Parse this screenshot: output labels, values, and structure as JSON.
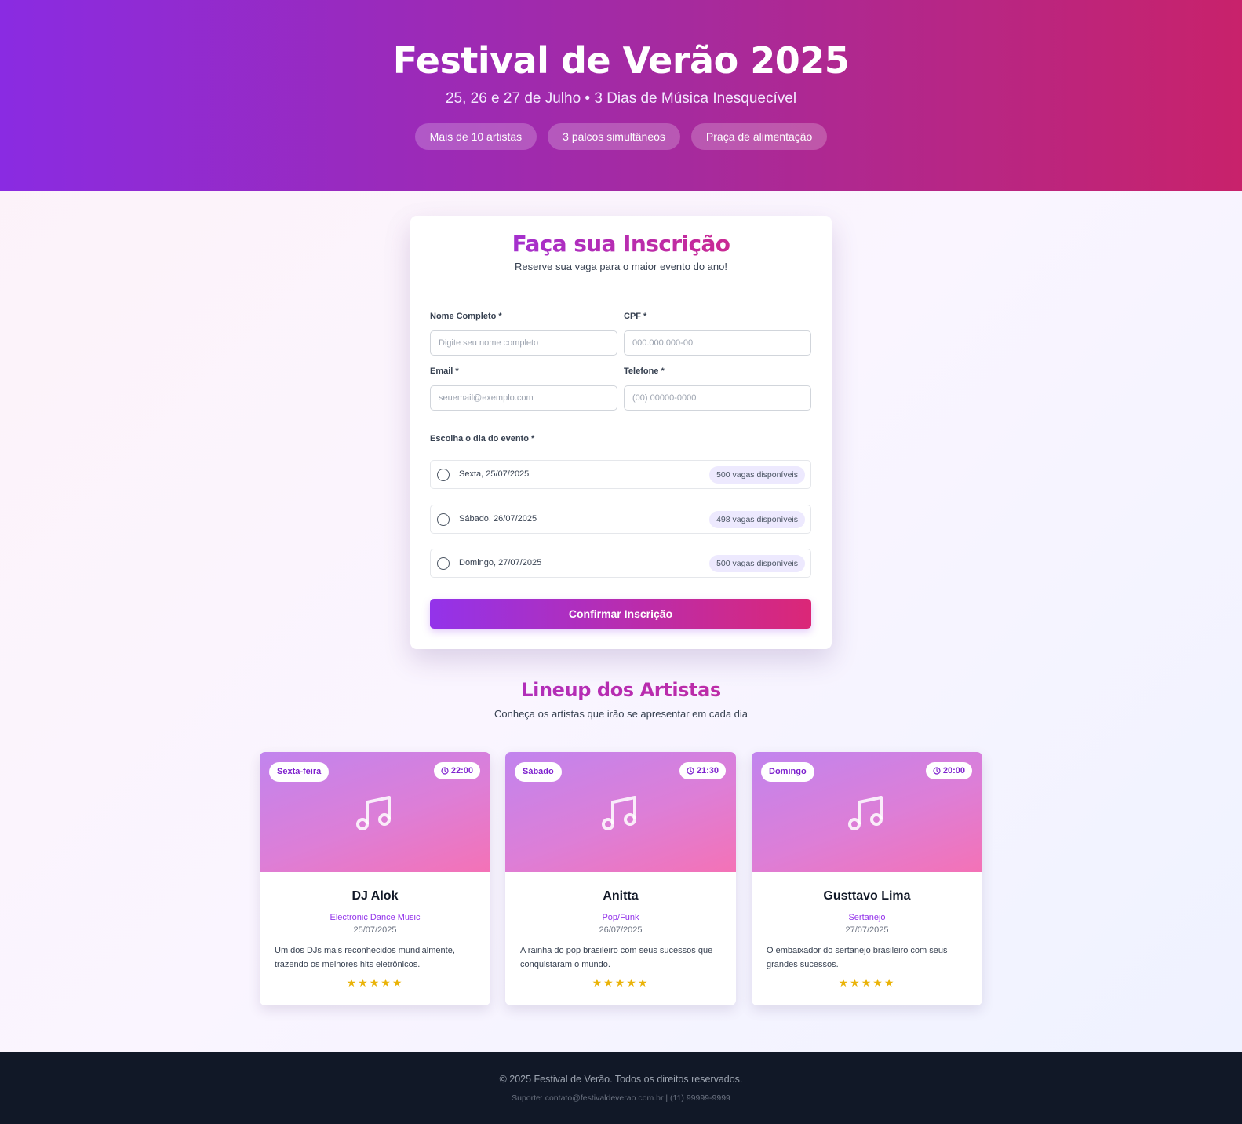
{
  "hero": {
    "title": "Festival de Verão 2025",
    "subtitle": "25, 26 e 27 de Julho • 3 Dias de Música Inesquecível",
    "chips": [
      "Mais de 10 artistas",
      "3 palcos simultâneos",
      "Praça de alimentação"
    ]
  },
  "form": {
    "title": "Faça sua Inscrição",
    "subtitle": "Reserve sua vaga para o maior evento do ano!",
    "fields": {
      "name": {
        "label": "Nome Completo *",
        "placeholder": "Digite seu nome completo",
        "value": ""
      },
      "cpf": {
        "label": "CPF *",
        "placeholder": "000.000.000-00",
        "value": ""
      },
      "email": {
        "label": "Email *",
        "placeholder": "seuemail@exemplo.com",
        "value": ""
      },
      "phone": {
        "label": "Telefone *",
        "placeholder": "(00) 00000-0000",
        "value": ""
      }
    },
    "day_label": "Escolha o dia do evento *",
    "days": [
      {
        "label": "Sexta, 25/07/2025",
        "vagas": "500 vagas disponíveis",
        "selected": false
      },
      {
        "label": "Sábado, 26/07/2025",
        "vagas": "498 vagas disponíveis",
        "selected": false
      },
      {
        "label": "Domingo, 27/07/2025",
        "vagas": "500 vagas disponíveis",
        "selected": false
      }
    ],
    "submit_label": "Confirmar Inscrição"
  },
  "lineup": {
    "title": "Lineup dos Artistas",
    "subtitle": "Conheça os artistas que irão se apresentar em cada dia",
    "artists": [
      {
        "day": "Sexta-feira",
        "time": "22:00",
        "name": "DJ Alok",
        "genre": "Electronic Dance Music",
        "date": "25/07/2025",
        "description": "Um dos DJs mais reconhecidos mundialmente, trazendo os melhores hits eletrônicos.",
        "rating": 5,
        "stars": "★★★★★",
        "icon": "music-note-icon"
      },
      {
        "day": "Sábado",
        "time": "21:30",
        "name": "Anitta",
        "genre": "Pop/Funk",
        "date": "26/07/2025",
        "description": "A rainha do pop brasileiro com seus sucessos que conquistaram o mundo.",
        "rating": 5,
        "stars": "★★★★★",
        "icon": "music-note-icon"
      },
      {
        "day": "Domingo",
        "time": "20:00",
        "name": "Gusttavo Lima",
        "genre": "Sertanejo",
        "date": "27/07/2025",
        "description": "O embaixador do sertanejo brasileiro com seus grandes sucessos.",
        "rating": 5,
        "stars": "★★★★★",
        "icon": "music-note-icon"
      }
    ]
  },
  "footer": {
    "copyright": "© 2025 Festival de Verão. Todos os direitos reservados.",
    "support": "Suporte: contato@festivaldeverao.com.br | (11) 99999-9999"
  },
  "colors": {
    "accent_purple": "#9333ea",
    "accent_pink": "#db2777",
    "star": "#eab308",
    "footer_bg": "#111827"
  }
}
